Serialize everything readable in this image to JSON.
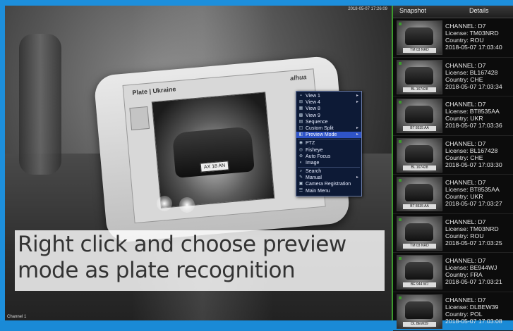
{
  "video": {
    "timestamp": "2018-05-07 17:26:09",
    "channel_label": "Channel 1",
    "phone_screen_title": "Plate | Ukraine",
    "phone_screen_logo": "alhua",
    "car_plate_text": "AX 18 AN"
  },
  "context_menu": {
    "items": [
      {
        "label": "View 1",
        "icon": "single-view-icon",
        "submenu": true
      },
      {
        "label": "View 4",
        "icon": "quad-view-icon",
        "submenu": true
      },
      {
        "label": "View 8",
        "icon": "eight-view-icon",
        "submenu": false
      },
      {
        "label": "View 9",
        "icon": "nine-view-icon",
        "submenu": false
      },
      {
        "label": "Sequence",
        "icon": "sequence-icon",
        "submenu": false
      },
      {
        "label": "Custom Split",
        "icon": "custom-split-icon",
        "submenu": true
      },
      {
        "label": "Preview Mode",
        "icon": "preview-mode-icon",
        "submenu": true,
        "active": true
      },
      {
        "label": "PTZ",
        "icon": "ptz-icon",
        "submenu": false
      },
      {
        "label": "Fisheye",
        "icon": "fisheye-icon",
        "submenu": false
      },
      {
        "label": "Auto Focus",
        "icon": "auto-focus-icon",
        "submenu": false
      },
      {
        "label": "Image",
        "icon": "image-icon",
        "submenu": false
      },
      {
        "label": "Search",
        "icon": "search-icon",
        "submenu": false
      },
      {
        "label": "Manual",
        "icon": "manual-icon",
        "submenu": true
      },
      {
        "label": "Camera Registration",
        "icon": "camera-registration-icon",
        "submenu": false
      },
      {
        "label": "Main Menu",
        "icon": "main-menu-icon",
        "submenu": false
      }
    ]
  },
  "caption": {
    "line1": "Right click and choose preview",
    "line2": "mode as plate recognition"
  },
  "panel": {
    "tab_snapshot": "Snapshot",
    "tab_details": "Details",
    "snapshots": [
      {
        "channel": "CHANNEL: D7",
        "license": "License: TM03NRD",
        "country": "Country: ROU",
        "time": "2018-05-07 17:03:40",
        "plate": "TM 03 NRD"
      },
      {
        "channel": "CHANNEL: D7",
        "license": "License: BL167428",
        "country": "Country: CHE",
        "time": "2018-05-07 17:03:34",
        "plate": "BL 167428"
      },
      {
        "channel": "CHANNEL: D7",
        "license": "License: BT8535AA",
        "country": "Country: UKR",
        "time": "2018-05-07 17:03:36",
        "plate": "BT 8535 AA"
      },
      {
        "channel": "CHANNEL: D7",
        "license": "License: BL167428",
        "country": "Country: CHE",
        "time": "2018-05-07 17:03:30",
        "plate": "BL 167428"
      },
      {
        "channel": "CHANNEL: D7",
        "license": "License: BT8535AA",
        "country": "Country: UKR",
        "time": "2018-05-07 17:03:27",
        "plate": "BT 8535 AA"
      },
      {
        "channel": "CHANNEL: D7",
        "license": "License: TM03NRD",
        "country": "Country: ROU",
        "time": "2018-05-07 17:03:25",
        "plate": "TM 03 NRD"
      },
      {
        "channel": "CHANNEL: D7",
        "license": "License: BE944WJ",
        "country": "Country: FRA",
        "time": "2018-05-07 17:03:21",
        "plate": "BE 944 WJ"
      },
      {
        "channel": "CHANNEL: D7",
        "license": "License: DLBEW39",
        "country": "Country: POL",
        "time": "2018-05-07 17:03:08",
        "plate": "DL BEW39"
      }
    ]
  }
}
